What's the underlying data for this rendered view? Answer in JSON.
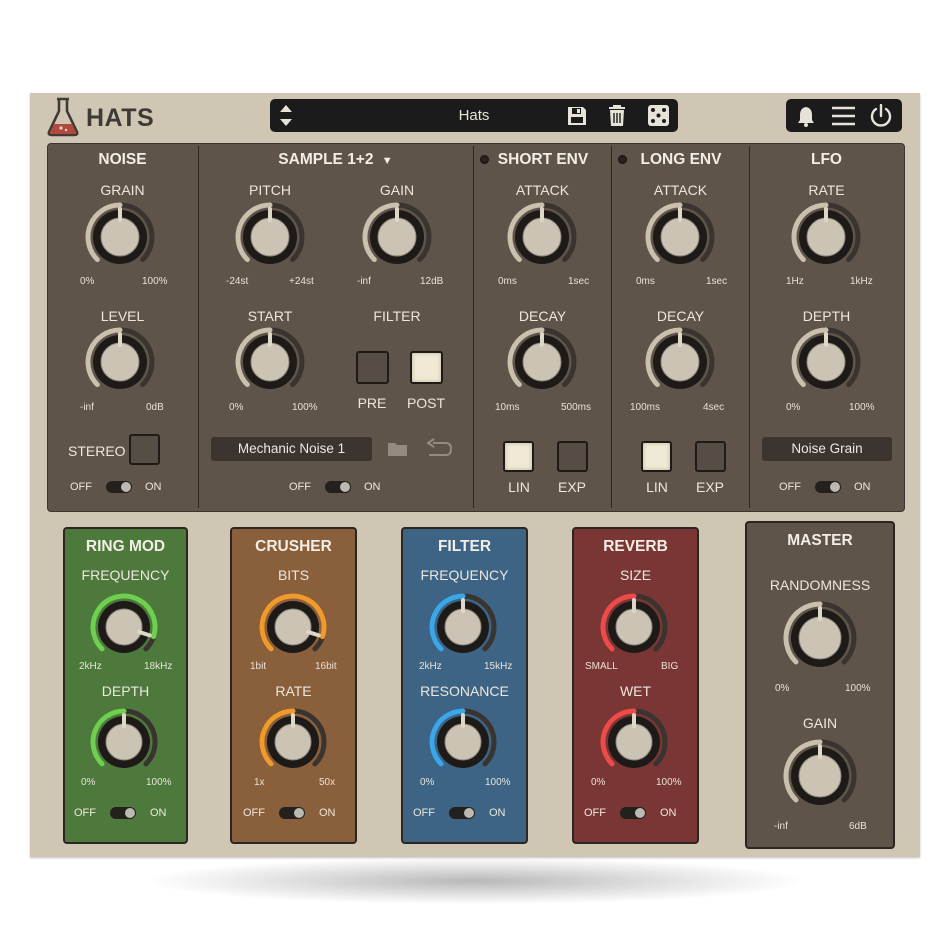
{
  "app": {
    "title": "HATS",
    "preset": "Hats"
  },
  "colors": {
    "body": "#cfc7b3",
    "panel": "#5f544a",
    "ring_mod": "#4d7a3c",
    "crusher": "#8a5f3c",
    "filter": "#3d6485",
    "reverb": "#7a3634",
    "master": "#5f544a"
  },
  "icons": {
    "logo": "flask-icon",
    "preset_nav": "up-down-arrows-icon",
    "save": "save-icon",
    "delete": "trash-icon",
    "random": "dice-icon",
    "notify": "bell-icon",
    "menu": "hamburger-menu-icon",
    "power": "power-icon",
    "browse": "folder-icon",
    "reverse": "loop-arrow-icon",
    "dropdown": "caret-down-icon"
  },
  "noise": {
    "title": "NOISE",
    "grain": {
      "label": "GRAIN",
      "min": "0%",
      "max": "100%",
      "value": 0.5
    },
    "level": {
      "label": "LEVEL",
      "min": "-inf",
      "max": "0dB",
      "value": 0.5
    },
    "stereo_label": "STEREO",
    "stereo_on": false,
    "toggle": {
      "off": "OFF",
      "on": "ON",
      "state": true
    }
  },
  "sample": {
    "title": "SAMPLE 1+2",
    "pitch": {
      "label": "PITCH",
      "min": "-24st",
      "max": "+24st",
      "value": 0.5
    },
    "gain": {
      "label": "GAIN",
      "min": "-inf",
      "max": "12dB",
      "value": 0.5
    },
    "start": {
      "label": "START",
      "min": "0%",
      "max": "100%",
      "value": 0.5
    },
    "filter_label": "FILTER",
    "pre_label": "PRE",
    "post_label": "POST",
    "pre_on": false,
    "post_on": true,
    "sample_name": "Mechanic Noise 1",
    "toggle": {
      "off": "OFF",
      "on": "ON",
      "state": true
    }
  },
  "short_env": {
    "title": "SHORT ENV",
    "attack": {
      "label": "ATTACK",
      "min": "0ms",
      "max": "1sec",
      "value": 0.5
    },
    "decay": {
      "label": "DECAY",
      "min": "10ms",
      "max": "500ms",
      "value": 0.5
    },
    "lin_label": "LIN",
    "exp_label": "EXP",
    "lin_on": true
  },
  "long_env": {
    "title": "LONG ENV",
    "attack": {
      "label": "ATTACK",
      "min": "0ms",
      "max": "1sec",
      "value": 0.5
    },
    "decay": {
      "label": "DECAY",
      "min": "100ms",
      "max": "4sec",
      "value": 0.5
    },
    "lin_label": "LIN",
    "exp_label": "EXP",
    "lin_on": true
  },
  "lfo": {
    "title": "LFO",
    "rate": {
      "label": "RATE",
      "min": "1Hz",
      "max": "1kHz",
      "value": 0.5
    },
    "depth": {
      "label": "DEPTH",
      "min": "0%",
      "max": "100%",
      "value": 0.5
    },
    "target": "Noise Grain",
    "toggle": {
      "off": "OFF",
      "on": "ON",
      "state": true
    }
  },
  "ring_mod": {
    "title": "RING MOD",
    "frequency": {
      "label": "FREQUENCY",
      "min": "2kHz",
      "max": "18kHz",
      "value": 0.9
    },
    "depth": {
      "label": "DEPTH",
      "min": "0%",
      "max": "100%",
      "value": 0.5
    },
    "toggle": {
      "off": "OFF",
      "on": "ON",
      "state": true
    }
  },
  "crusher": {
    "title": "CRUSHER",
    "bits": {
      "label": "BITS",
      "min": "1bit",
      "max": "16bit",
      "value": 0.9
    },
    "rate": {
      "label": "RATE",
      "min": "1x",
      "max": "50x",
      "value": 0.5
    },
    "toggle": {
      "off": "OFF",
      "on": "ON",
      "state": true
    }
  },
  "filter": {
    "title": "FILTER",
    "frequency": {
      "label": "FREQUENCY",
      "min": "2kHz",
      "max": "15kHz",
      "value": 0.5
    },
    "resonance": {
      "label": "RESONANCE",
      "min": "0%",
      "max": "100%",
      "value": 0.5
    },
    "toggle": {
      "off": "OFF",
      "on": "ON",
      "state": true
    }
  },
  "reverb": {
    "title": "REVERB",
    "size": {
      "label": "SIZE",
      "min": "SMALL",
      "max": "BIG",
      "value": 0.5
    },
    "wet": {
      "label": "WET",
      "min": "0%",
      "max": "100%",
      "value": 0.5
    },
    "toggle": {
      "off": "OFF",
      "on": "ON",
      "state": true
    }
  },
  "master": {
    "title": "MASTER",
    "randomness": {
      "label": "RANDOMNESS",
      "min": "0%",
      "max": "100%",
      "value": 0.5
    },
    "gain": {
      "label": "GAIN",
      "min": "-inf",
      "max": "6dB",
      "value": 0.5
    }
  }
}
